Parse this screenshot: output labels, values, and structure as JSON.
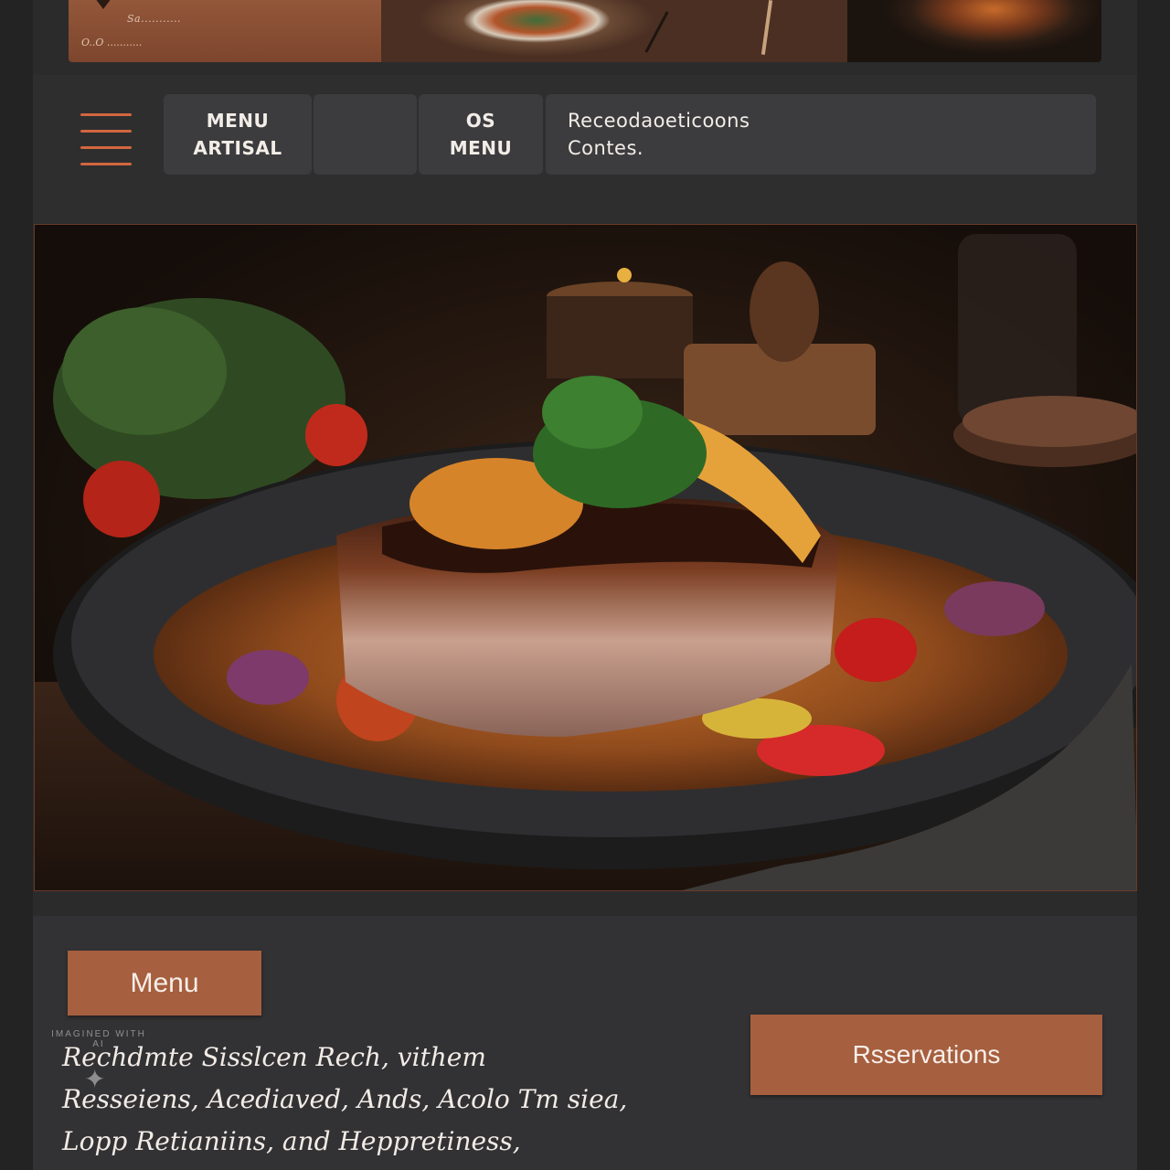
{
  "banner": {
    "tagline": "Sa...........",
    "contact": "O..O ..........."
  },
  "nav": {
    "menu_artisan_line1": "MENU",
    "menu_artisan_line2": "ARTISAL",
    "menu_os_line1": "OS",
    "menu_os_line2": "MENU",
    "info_line1": "Receodaoeticoons",
    "info_line2": "Contes."
  },
  "hero": {
    "alt": "Grilled fish fillet with vegetables in sauce on a dark plate"
  },
  "footer": {
    "menu_button": "Menu",
    "reservations_button": "Rsservations",
    "body_lines": [
      "Rechdmte Sisslcen Rech, vithem",
      "Resseiens, Acediaved, Ands, Acolo Tm siea,",
      "Lopp Retianiins, and Heppretiness,"
    ],
    "watermark": "IMAGINED WITH AI"
  },
  "colors": {
    "accent": "#a65f3f",
    "hamburger": "#d2663e",
    "background": "#2b2b2c",
    "nav_box": "#3c3c3e"
  }
}
